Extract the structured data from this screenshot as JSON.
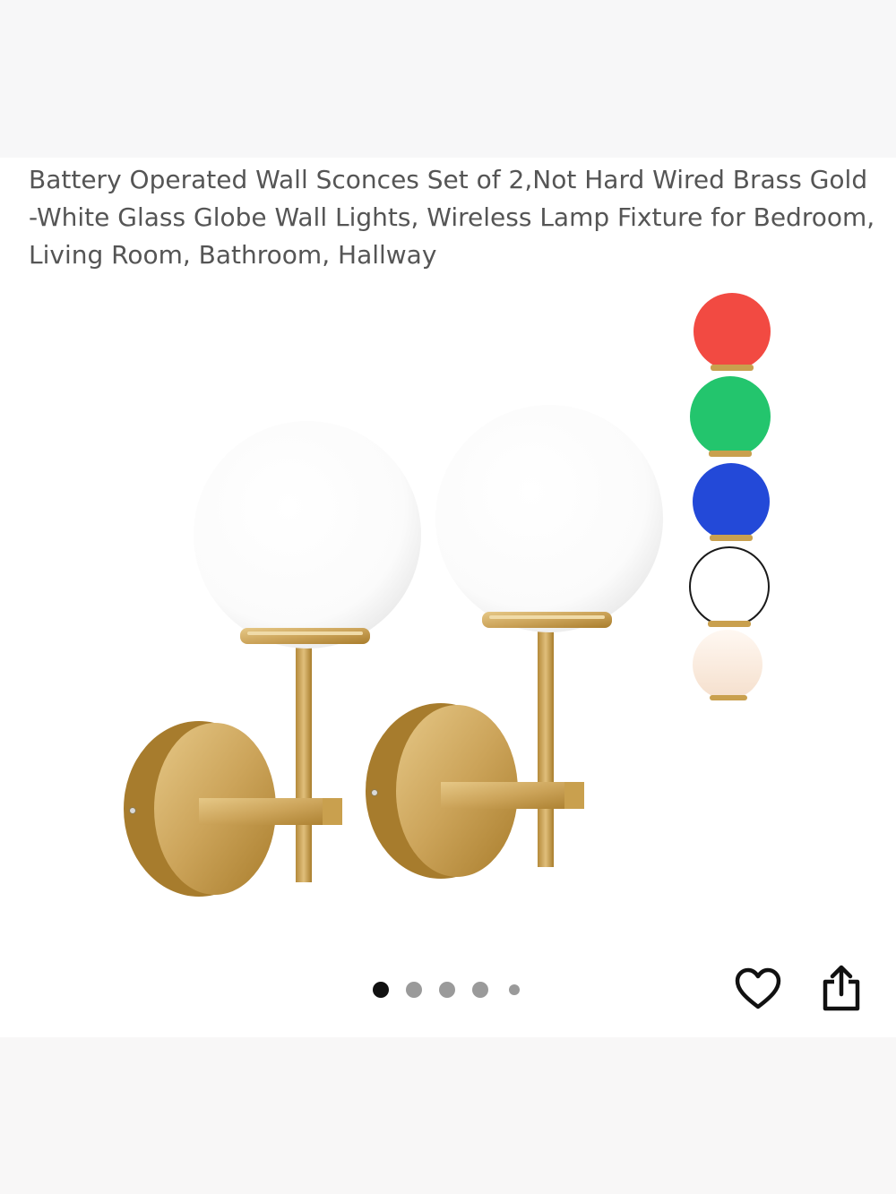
{
  "product": {
    "title": "Battery Operated Wall Sconces Set of 2,Not Hard Wired Brass Gold -White Glass Globe Wall Lights, Wireless Lamp Fixture for Bedroom, Living Room, Bathroom, Hallway"
  },
  "gallery": {
    "image_count": 5,
    "active_index": 0,
    "color_options": [
      {
        "name": "red",
        "color": "#f24a42"
      },
      {
        "name": "green",
        "color": "#23c56d"
      },
      {
        "name": "blue",
        "color": "#2349d8"
      },
      {
        "name": "white",
        "color": "#ffffff"
      },
      {
        "name": "warm-white",
        "color": "#fbeee2"
      }
    ]
  },
  "actions": {
    "wishlist_icon": "heart-icon",
    "share_icon": "share-icon"
  },
  "colors": {
    "brass": "#c9a04e",
    "brass_dark": "#a97d2c",
    "text": "#555555",
    "dot_active": "#111111",
    "dot_inactive": "#9a9a9a"
  }
}
